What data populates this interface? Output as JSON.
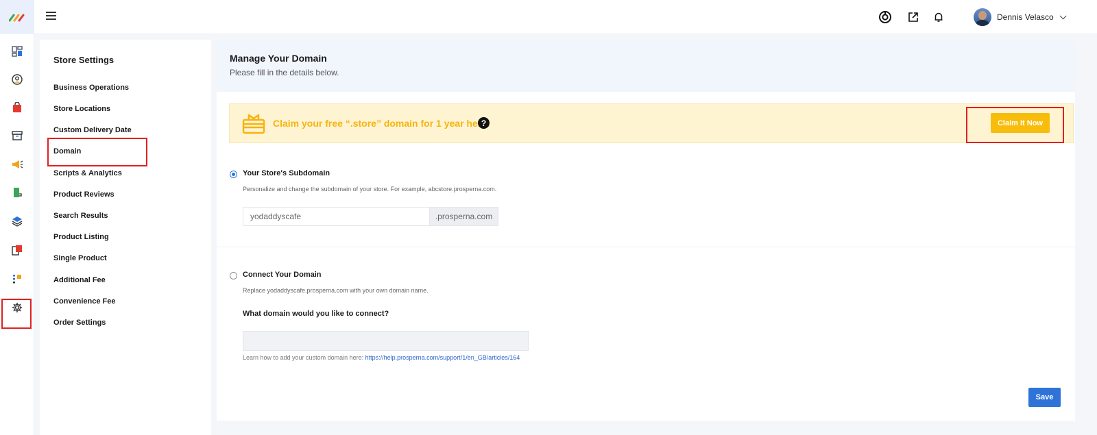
{
  "topbar": {
    "user_name": "Dennis Velasco"
  },
  "settings": {
    "title": "Store Settings",
    "items": [
      {
        "label": "Business Operations"
      },
      {
        "label": "Store Locations"
      },
      {
        "label": "Custom Delivery Date"
      },
      {
        "label": "Domain"
      },
      {
        "label": "Scripts & Analytics"
      },
      {
        "label": "Product Reviews"
      },
      {
        "label": "Search Results"
      },
      {
        "label": "Product Listing"
      },
      {
        "label": "Single Product"
      },
      {
        "label": "Additional Fee"
      },
      {
        "label": "Convenience Fee"
      },
      {
        "label": "Order Settings"
      }
    ]
  },
  "main": {
    "title": "Manage Your Domain",
    "subtitle": "Please fill in the details below.",
    "promo": {
      "text": "Claim your free “.store” domain for 1 year here!",
      "help_glyph": "?",
      "button_label": "Claim It Now"
    },
    "subdomain": {
      "title": "Your Store's Subdomain",
      "description": "Personalize and change the subdomain of your store. For example, abcstore.prosperna.com.",
      "value": "yodaddyscafe",
      "suffix": ".prosperna.com",
      "selected": true
    },
    "connect": {
      "title": "Connect Your Domain",
      "description": "Replace yodaddyscafe.prosperna.com with your own domain name.",
      "question": "What domain would you like to connect?",
      "value": "",
      "help_prefix": "Learn how to add your custom domain here: ",
      "help_link": "https://help.prosperna.com/support/1/en_GB/articles/164",
      "selected": false
    },
    "save_label": "Save"
  },
  "colors": {
    "accent": "#2f73d9",
    "promo_text": "#f6b40e",
    "promo_button": "#f8bd0b",
    "highlight": "#e02020"
  }
}
